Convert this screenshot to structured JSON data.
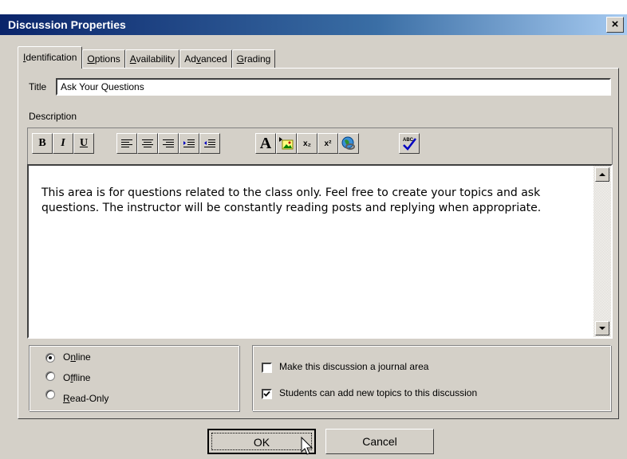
{
  "window": {
    "title": "Discussion Properties",
    "close_label": "×"
  },
  "tabs": [
    {
      "label": "Identification",
      "access": "I",
      "rest": "dentification",
      "active": true
    },
    {
      "label": "Options",
      "access": "O",
      "rest": "ptions"
    },
    {
      "label": "Availability",
      "access": "A",
      "rest": "vailability"
    },
    {
      "label": "Advanced",
      "pre": "Ad",
      "access": "v",
      "rest": "anced"
    },
    {
      "label": "Grading",
      "access": "G",
      "rest": "rading"
    }
  ],
  "identification": {
    "title_label": "Title",
    "title_value": "Ask Your Questions",
    "description_label": "Description",
    "description_text": "This area is for questions related to the class only.  Feel free to create your topics and ask questions.  The instructor will be constantly reading posts and replying when appropriate."
  },
  "toolbar": {
    "bold": "B",
    "italic": "I",
    "underline": "U",
    "font": "A",
    "subscript": "x₂",
    "superscript": "x²",
    "spellcheck": "ABC"
  },
  "status_options": [
    {
      "label": "Online",
      "access": "n",
      "pre": "O",
      "rest": "line",
      "selected": true
    },
    {
      "label": "Offline",
      "pre": "O",
      "access": "f",
      "rest": "fline",
      "selected": false
    },
    {
      "label": "Read-Only",
      "pre": "",
      "access": "R",
      "rest": "ead-Only",
      "selected": false
    }
  ],
  "checkboxes": [
    {
      "label": "Make this discussion a journal area",
      "checked": false
    },
    {
      "label": "Students can add new topics to this discussion",
      "checked": true
    }
  ],
  "buttons": {
    "ok": "OK",
    "cancel": "Cancel"
  },
  "colors": {
    "titlebar": "#0a246a",
    "face": "#d4d0c8"
  }
}
